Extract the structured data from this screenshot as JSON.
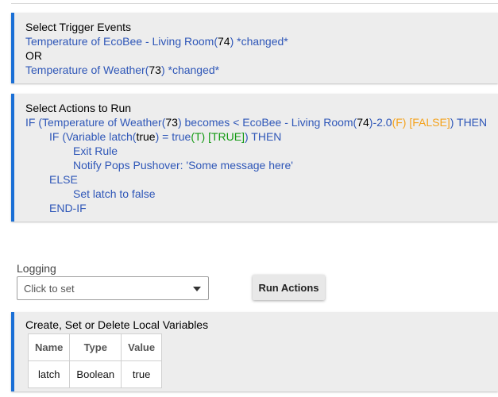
{
  "trigger": {
    "title": "Select Trigger Events",
    "line1": {
      "a": "Temperature of EcoBee - Living Room(",
      "b": "74",
      "c": ") *changed*"
    },
    "or": "OR",
    "line2": {
      "a": "Temperature of Weather(",
      "b": "73",
      "c": ") *changed*"
    }
  },
  "actions": {
    "title": "Select Actions to Run",
    "if1": {
      "a": "IF (Temperature of Weather(",
      "b": "73",
      "c": ") becomes < EcoBee - Living Room(",
      "d": "74",
      "e": ")-2.0",
      "f": "(F) [FALSE]",
      "g": ") THEN"
    },
    "if2": {
      "a": "IF (Variable latch(",
      "b": "true",
      "c": ") = true",
      "d": "(T) [TRUE]",
      "e": ") THEN"
    },
    "exit_rule": "Exit Rule",
    "notify": "Notify Pops Pushover: 'Some message here'",
    "else": "ELSE",
    "set_latch": "Set latch to false",
    "endif": "END-IF"
  },
  "logging": {
    "label": "Logging",
    "select_value": "Click to set"
  },
  "run_actions_label": "Run Actions",
  "local_vars": {
    "title": "Create, Set or Delete Local Variables",
    "headers": [
      "Name",
      "Type",
      "Value"
    ],
    "rows": [
      [
        "latch",
        "Boolean",
        "true"
      ]
    ]
  },
  "colors": {
    "accent": "#1a6fd6",
    "link_blue": "#2f57b8",
    "orange": "#f4a21c",
    "green": "#139a13",
    "card_bg": "#ededed"
  }
}
